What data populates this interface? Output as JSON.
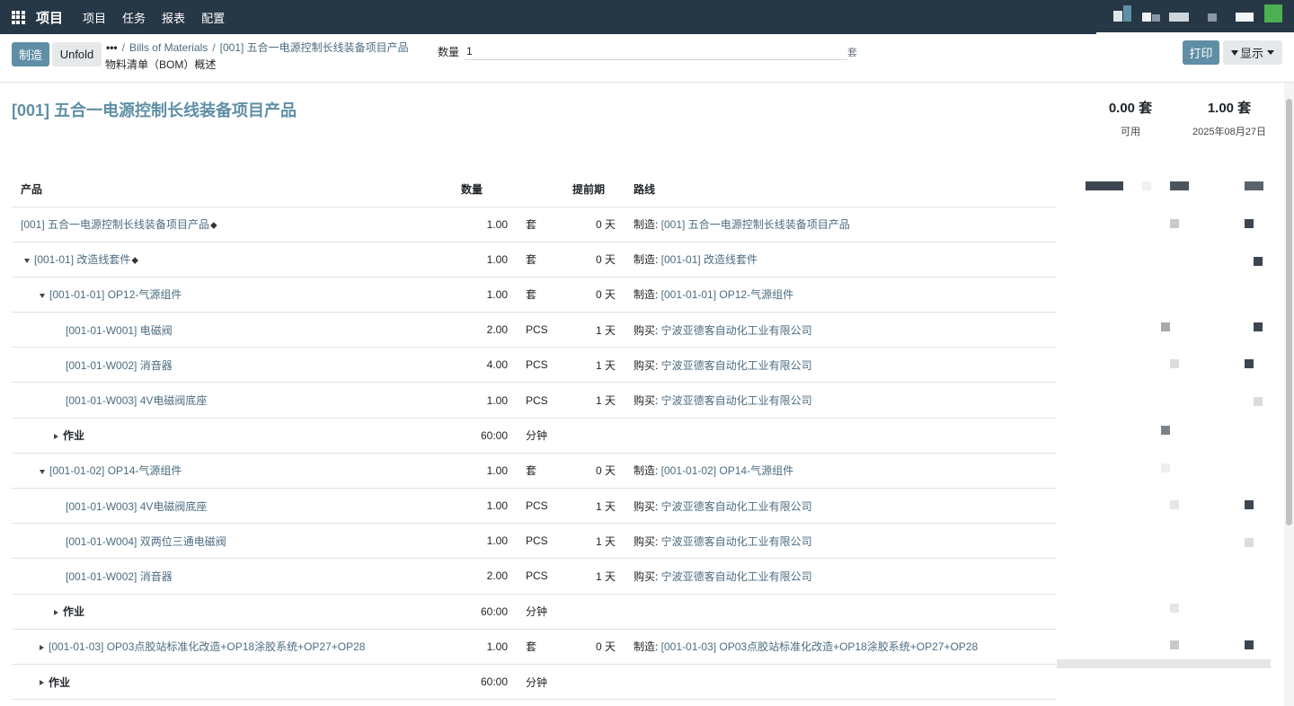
{
  "navbar": {
    "app_name": "项目",
    "menu": [
      "项目",
      "任务",
      "报表",
      "配置"
    ],
    "bg_color": "#263746"
  },
  "control": {
    "manufacture_button": "制造",
    "unfold_button": "Unfold",
    "breadcrumb_dots": "•••",
    "breadcrumb_1": "Bills of Materials",
    "breadcrumb_2": "[001] 五合一电源控制长线装备项目产品",
    "subtitle": "物料清单（BOM）概述",
    "quantity_label": "数量",
    "quantity_value": "1",
    "quantity_uom": "套",
    "print_button": "打印",
    "display_button": "显示",
    "accent_color": "#5f8fa6"
  },
  "report": {
    "title": "[001] 五合一电源控制长线装备项目产品",
    "available_qty": "0.00 套",
    "available_label": "可用",
    "forecast_qty": "1.00 套",
    "forecast_date": "2025年08月27日"
  },
  "table": {
    "headers": {
      "product": "产品",
      "quantity": "数量",
      "lead_time": "提前期",
      "route": "路线"
    },
    "rows": [
      {
        "product": "[001] 五合一电源控制长线装备项目产品",
        "qty": "1.00",
        "uom": "套",
        "lead": "0 天",
        "route_prefix": "制造: ",
        "route_link": "[001] 五合一电源控制长线装备项目产品"
      },
      {
        "product": "[001-01] 改造线套件",
        "qty": "1.00",
        "uom": "套",
        "lead": "0 天",
        "route_prefix": "制造: ",
        "route_link": "[001-01] 改造线套件"
      },
      {
        "product": "[001-01-01] OP12-气源组件",
        "qty": "1.00",
        "uom": "套",
        "lead": "0 天",
        "route_prefix": "制造: ",
        "route_link": "[001-01-01] OP12-气源组件"
      },
      {
        "product": "[001-01-W001] 电磁阀",
        "qty": "2.00",
        "uom": "PCS",
        "lead": "1 天",
        "route_prefix": "购买: ",
        "route_link": "宁波亚德客自动化工业有限公司"
      },
      {
        "product": "[001-01-W002] 消音器",
        "qty": "4.00",
        "uom": "PCS",
        "lead": "1 天",
        "route_prefix": "购买: ",
        "route_link": "宁波亚德客自动化工业有限公司"
      },
      {
        "product": "[001-01-W003] 4V电磁阀底座",
        "qty": "1.00",
        "uom": "PCS",
        "lead": "1 天",
        "route_prefix": "购买: ",
        "route_link": "宁波亚德客自动化工业有限公司"
      },
      {
        "product": "作业",
        "qty": "60:00",
        "uom": "分钟",
        "lead": "",
        "route_prefix": "",
        "route_link": ""
      },
      {
        "product": "[001-01-02] OP14-气源组件",
        "qty": "1.00",
        "uom": "套",
        "lead": "0 天",
        "route_prefix": "制造: ",
        "route_link": "[001-01-02] OP14-气源组件"
      },
      {
        "product": "[001-01-W003] 4V电磁阀底座",
        "qty": "1.00",
        "uom": "PCS",
        "lead": "1 天",
        "route_prefix": "购买: ",
        "route_link": "宁波亚德客自动化工业有限公司"
      },
      {
        "product": "[001-01-W004] 双两位三通电磁阀",
        "qty": "1.00",
        "uom": "PCS",
        "lead": "1 天",
        "route_prefix": "购买: ",
        "route_link": "宁波亚德客自动化工业有限公司"
      },
      {
        "product": "[001-01-W002] 消音器",
        "qty": "2.00",
        "uom": "PCS",
        "lead": "1 天",
        "route_prefix": "购买: ",
        "route_link": "宁波亚德客自动化工业有限公司"
      },
      {
        "product": "作业",
        "qty": "60:00",
        "uom": "分钟",
        "lead": "",
        "route_prefix": "",
        "route_link": ""
      },
      {
        "product": "[001-01-03] OP03点胶站标准化改造+OP18涂胶系统+OP27+OP28",
        "qty": "1.00",
        "uom": "套",
        "lead": "0 天",
        "route_prefix": "制造: ",
        "route_link": "[001-01-03] OP03点胶站标准化改造+OP18涂胶系统+OP27+OP28"
      },
      {
        "product": "作业",
        "qty": "60:00",
        "uom": "分钟",
        "lead": "",
        "route_prefix": "",
        "route_link": ""
      }
    ]
  }
}
